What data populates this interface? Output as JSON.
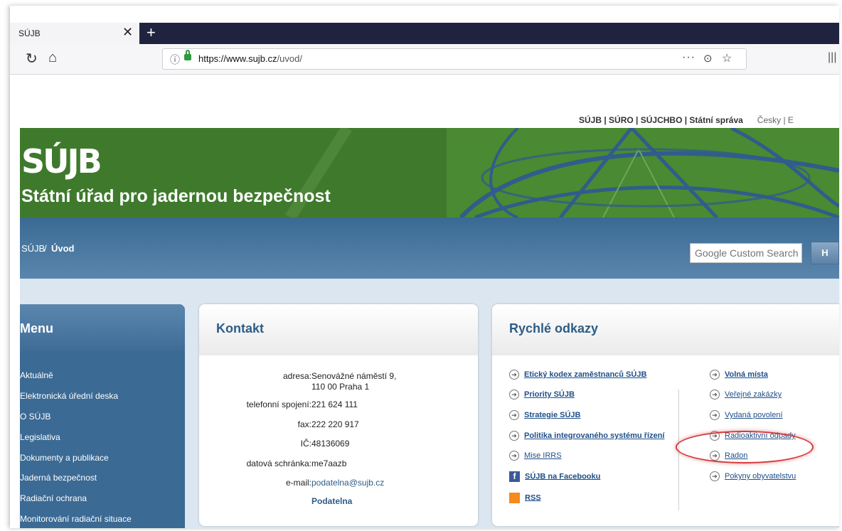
{
  "browser": {
    "tab_title": "SÚJB",
    "tab_close": "✕",
    "new_tab": "+",
    "reload_icon": "↻",
    "home_icon": "⌂",
    "url_host": "https://www.sujb.cz",
    "url_path": "/uvod/",
    "menu_dots": "···",
    "library_icon": "|||"
  },
  "site": {
    "toplinks": "SÚJB | SÚRO | SÚJCHBO | Státní správa",
    "lang": "Česky | E",
    "logo": "SÚJB",
    "subtitle": "Státní úřad pro jadernou bezpečnost",
    "breadcrumb_root": "SÚJB",
    "breadcrumb_sep": "/",
    "breadcrumb_current": "Úvod",
    "search_placeholder": "Google Custom Search",
    "search_button": "H"
  },
  "menu": {
    "title": "Menu",
    "items": [
      "Aktuálně",
      "Elektronická úřední deska",
      "O SÚJB",
      "Legislativa",
      "Dokumenty a publikace",
      "Jaderná bezpečnost",
      "Radiační ochrana",
      "Monitorování radiační situace"
    ]
  },
  "kontakt": {
    "title": "Kontakt",
    "rows": [
      {
        "label": "adresa:",
        "value": "Senovážné náměstí 9,",
        "value2": "110 00 Praha 1"
      },
      {
        "label": "telefonní spojení:",
        "value": "221 624 111"
      },
      {
        "label": "fax:",
        "value": "222 220 917"
      },
      {
        "label": "IČ:",
        "value": "48136069"
      },
      {
        "label": "datová schránka:",
        "value": "me7aazb"
      },
      {
        "label": "e-mail:",
        "value": "podatelna@sujb.cz"
      }
    ],
    "podatelna": "Podatelna"
  },
  "quick": {
    "title": "Rychlé odkazy",
    "left": [
      "Etický kodex zaměstnanců SÚJB",
      "Priority SÚJB",
      "Strategie SÚJB",
      "Politika integrovaného systému řízení",
      "Mise IRRS",
      "SÚJB na Facebooku",
      "RSS"
    ],
    "right": [
      "Volná místa",
      "Veřejné zakázky",
      "Vydaná povolení",
      "Radioaktivní odpady",
      "Radon",
      "Pokyny obyvatelstvu"
    ]
  }
}
